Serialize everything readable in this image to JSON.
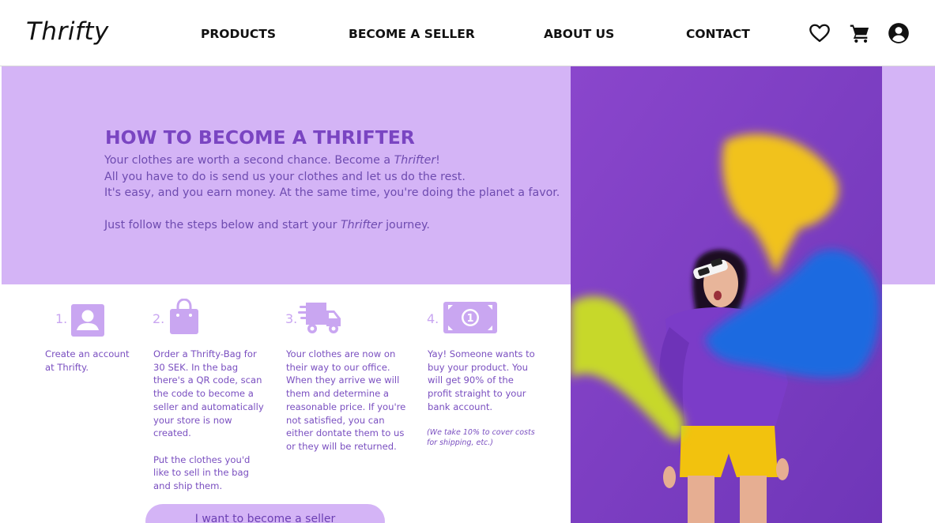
{
  "header": {
    "logo": "Thrifty",
    "nav": {
      "products": "PRODUCTS",
      "become_seller": "BECOME A SELLER",
      "about": "ABOUT US",
      "contact": "CONTACT"
    },
    "icons": [
      "heart-icon",
      "cart-icon",
      "account-icon"
    ]
  },
  "hero": {
    "title": "HOW TO BECOME A THRIFTER",
    "line1_a": "Your clothes are worth a second chance. Become a ",
    "line1_em": "Thrifter",
    "line1_b": "!",
    "line2": "All you have to do is send us your clothes and let us do the rest.",
    "line3": "It's easy, and you earn money. At the same time, you're doing the planet a favor.",
    "line4_a": "Just follow the steps below and start your ",
    "line4_em": "Thrifter",
    "line4_b": " journey."
  },
  "steps": [
    {
      "number": "1.",
      "icon": "account-box-icon",
      "lines": [
        "Create an account",
        "at Thrifty."
      ]
    },
    {
      "number": "2.",
      "icon": "shopping-bag-icon",
      "lines": [
        "Order a Thrifty-Bag for",
        "30 SEK.  In the bag",
        "there's a QR code, scan",
        "the code to become a",
        "seller and automatically",
        "your store is now",
        "created.",
        "",
        "Put the clothes you'd",
        "like to sell in the bag",
        "and ship them."
      ]
    },
    {
      "number": "3.",
      "icon": "delivery-truck-icon",
      "lines": [
        "Your clothes are now on",
        "their way to our office.",
        "When they arrive we will",
        "them and determine a",
        "reasonable price. If you're",
        "not satisfied, you can",
        "either dontate them to us",
        "or they will be returned."
      ]
    },
    {
      "number": "4.",
      "icon": "money-bill-icon",
      "lines": [
        "Yay! Someone wants to",
        "buy your product. You",
        "will get 90% of the",
        "profit straight to your",
        "bank account."
      ],
      "note": [
        "(We take 10% to cover costs",
        "for shipping, etc.)"
      ]
    }
  ],
  "cta": {
    "label": "I want to become a seller"
  },
  "colors": {
    "lavender": "#d4b4f6",
    "heading_purple": "#7a45c2",
    "text_purple": "#6e4bb0",
    "icon_lilac": "#c9a6f1",
    "photo_purple": "#7e3fc4"
  }
}
